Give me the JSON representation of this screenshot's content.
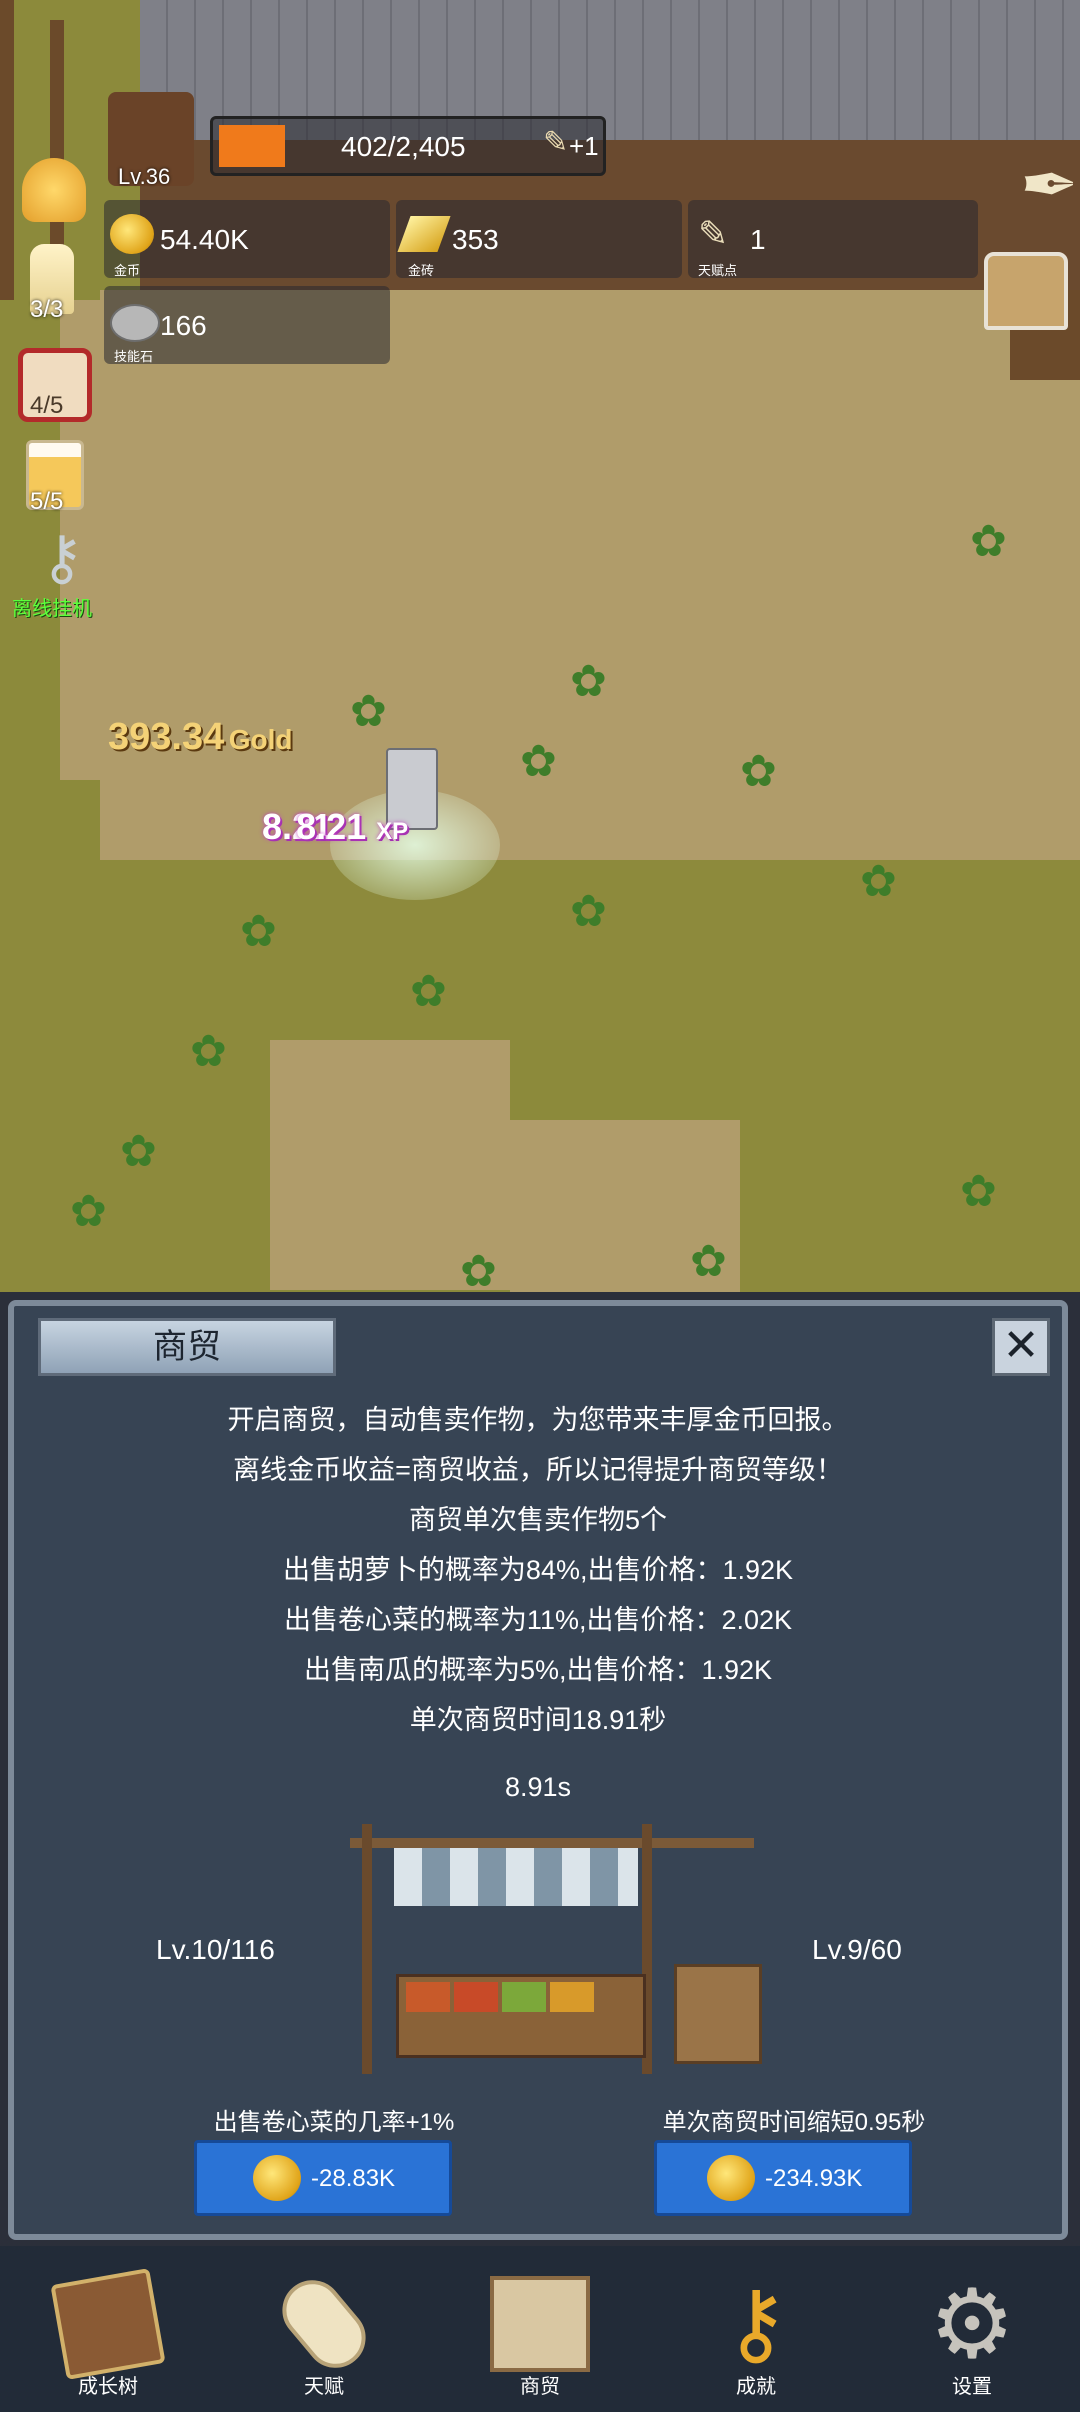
{
  "player": {
    "level": "Lv.36",
    "xp": "402/2,405",
    "xp_fill": 0.167,
    "bonus": "+1"
  },
  "resources": {
    "gold": {
      "value": "54.40K",
      "label": "金币"
    },
    "gold_brick": {
      "value": "353",
      "label": "金砖"
    },
    "talent": {
      "value": "1",
      "label": "天赋点"
    },
    "skill_stone": {
      "value": "166",
      "label": "技能石"
    }
  },
  "left_counters": {
    "candle": "3/3",
    "dice": "4/5",
    "beer": "5/5",
    "afk_label": "离线挂机"
  },
  "floating": {
    "gold": "393.34",
    "gold_unit": "Gold",
    "xp1": "8.21",
    "xp2": "8.21",
    "xp_unit": "XP"
  },
  "panel": {
    "title": "商贸",
    "close": "✕",
    "lines": [
      "开启商贸，自动售卖作物，为您带来丰厚金币回报。",
      "离线金币收益=商贸收益，所以记得提升商贸等级！",
      "商贸单次售卖作物5个",
      "出售胡萝卜的概率为84%,出售价格：1.92K",
      "出售卷心菜的概率为11%,出售价格：2.02K",
      "出售南瓜的概率为5%,出售价格：1.92K",
      "单次商贸时间18.91秒"
    ],
    "timer": "8.91s",
    "left_level": "Lv.10/116",
    "right_level": "Lv.9/60",
    "left_upgrade": {
      "label": "出售卷心菜的几率+1%",
      "cost": "-28.83K"
    },
    "right_upgrade": {
      "label": "单次商贸时间缩短0.95秒",
      "cost": "-234.93K"
    }
  },
  "nav": [
    {
      "label": "成长树",
      "icon": "book-icon"
    },
    {
      "label": "天赋",
      "icon": "scroll-icon"
    },
    {
      "label": "商贸",
      "icon": "map-icon"
    },
    {
      "label": "成就",
      "icon": "key-icon"
    },
    {
      "label": "设置",
      "icon": "gear-icon"
    }
  ]
}
